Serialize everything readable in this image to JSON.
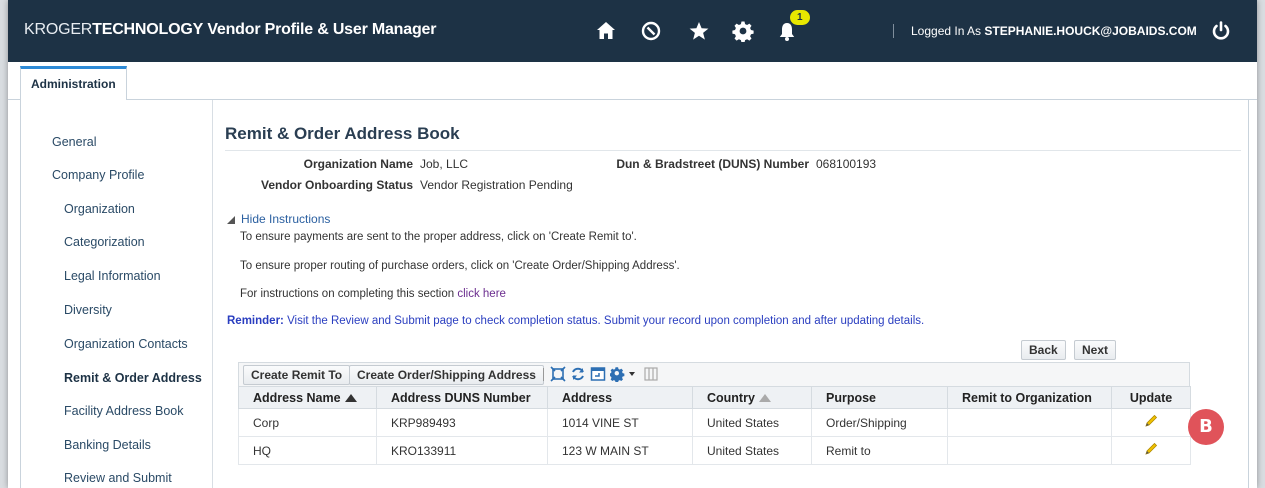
{
  "header": {
    "brand_prefix": "KROGER",
    "brand_bold": "TECHNOLOGY",
    "app_title": "Vendor Profile & User Manager",
    "notification_count": "1",
    "logged_in_prefix": "Logged In As",
    "logged_in_user": "STEPHANIE.HOUCK@JOBAIDS.COM",
    "icons": [
      "home-icon",
      "compass-icon",
      "star-icon",
      "gear-icon",
      "bell-icon",
      "power-icon"
    ]
  },
  "tabs": [
    {
      "label": "Administration"
    }
  ],
  "sidebar": {
    "items": [
      {
        "label": "General"
      },
      {
        "label": "Company Profile"
      },
      {
        "label": "Organization"
      },
      {
        "label": "Categorization"
      },
      {
        "label": "Legal Information"
      },
      {
        "label": "Diversity"
      },
      {
        "label": "Organization Contacts"
      },
      {
        "label": "Remit & Order Address"
      },
      {
        "label": "Facility Address Book"
      },
      {
        "label": "Banking Details"
      },
      {
        "label": "Review and Submit"
      }
    ],
    "active": "Remit & Order Address"
  },
  "page": {
    "title": "Remit & Order Address Book",
    "org_name_label": "Organization Name",
    "org_name_value": "Job, LLC",
    "duns_label": "Dun & Bradstreet (DUNS) Number",
    "duns_value": "068100193",
    "status_label": "Vendor Onboarding Status",
    "status_value": "Vendor Registration Pending"
  },
  "instructions": {
    "toggle": "Hide Instructions",
    "line1": "To ensure payments are sent to the proper address, click on 'Create Remit to'.",
    "line2": "To ensure proper routing of purchase orders, click on 'Create Order/Shipping Address'.",
    "line3_prefix": "For instructions on completing this section",
    "line3_link": "click here",
    "reminder_label": "Reminder:",
    "reminder_text": "Visit the Review and Submit page to check completion status. Submit your record upon completion and after updating details."
  },
  "nav_buttons": {
    "back": "Back",
    "next": "Next"
  },
  "toolbar": {
    "create_remit": "Create Remit To",
    "create_order": "Create Order/Shipping Address",
    "icons": [
      "detach-icon",
      "refresh-icon",
      "freeze-icon",
      "settings-icon",
      "columns-icon"
    ]
  },
  "table": {
    "columns": [
      "Address Name",
      "Address DUNS Number",
      "Address",
      "Country",
      "Purpose",
      "Remit to Organization",
      "Update"
    ],
    "rows": [
      {
        "name": "Corp",
        "duns": "KRP989493",
        "address": "1014 VINE ST",
        "country": "United States",
        "purpose": "Order/Shipping",
        "remit_org": ""
      },
      {
        "name": "HQ",
        "duns": "KRO133911",
        "address": "123 W MAIN ST",
        "country": "United States",
        "purpose": "Remit to",
        "remit_org": ""
      }
    ]
  },
  "callout": {
    "label": "B",
    "color": "#e0535a"
  },
  "colors": {
    "header_bg": "#1d3245",
    "tab_accent": "#2d8ad6",
    "badge": "#e8e800"
  }
}
